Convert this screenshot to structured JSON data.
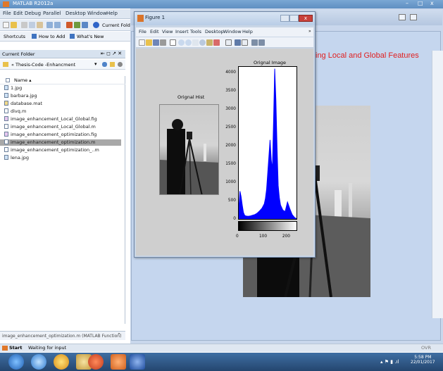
{
  "matlab": {
    "title": "MATLAB R2012a",
    "menu": [
      "File",
      "Edit",
      "Debug",
      "Parallel",
      "Desktop",
      "Window",
      "Help"
    ],
    "current_folder_label": "Current Folder:",
    "shortcuts": [
      "Shortcuts",
      "How to Add",
      "What's New"
    ],
    "window_controls": [
      "–",
      "□",
      "x"
    ]
  },
  "current_folder": {
    "panel_title": "Current Folder",
    "path": "« Thesis-Code -Enhancment",
    "column_header": "Name ▴",
    "files": [
      {
        "name": "1.jpg",
        "icon": "image-file-icon"
      },
      {
        "name": "barbara.jpg",
        "icon": "image-file-icon"
      },
      {
        "name": "database.mat",
        "icon": "mat-file-icon"
      },
      {
        "name": "divq.m",
        "icon": "m-file-icon"
      },
      {
        "name": "image_enhancement_Local_Global.fig",
        "icon": "fig-file-icon"
      },
      {
        "name": "image_enhancement_Local_Global.m",
        "icon": "m-file-icon"
      },
      {
        "name": "image_enhancement_optimization.fig",
        "icon": "fig-file-icon"
      },
      {
        "name": "image_enhancement_optimization.m",
        "icon": "m-file-icon",
        "selected": true
      },
      {
        "name": "image_enhancement_optimization_..m",
        "icon": "m-file-icon"
      },
      {
        "name": "lena.jpg",
        "icon": "image-file-icon"
      }
    ],
    "details": "image_enhancement_optimization.m (MATLAB Function)"
  },
  "status": {
    "start": "Start",
    "text": "Waiting for input",
    "ovr": "OVR"
  },
  "gui": {
    "heading_fragment": "ing Local and Global Features"
  },
  "figure": {
    "title": "Figure 1",
    "menu": [
      "File",
      "Edit",
      "View",
      "Insert",
      "Tools",
      "Desktop",
      "Window",
      "Help"
    ],
    "left_title": "Orignal Hist",
    "right_title": "Orignal Image"
  },
  "chart_data": {
    "type": "area",
    "title": "Orignal Image",
    "xlabel": "",
    "ylabel": "",
    "xlim": [
      0,
      255
    ],
    "ylim": [
      0,
      4200
    ],
    "y_ticks": [
      0,
      500,
      1000,
      1500,
      2000,
      2500,
      3000,
      3500,
      4000
    ],
    "x_ticks": [
      0,
      100,
      200
    ],
    "grid": false,
    "color": "#0000ff",
    "series": [
      {
        "x": [
          0,
          5,
          10,
          15,
          20,
          25,
          30,
          40,
          50,
          60,
          70,
          80,
          90,
          100,
          110,
          115,
          120,
          125,
          130,
          135,
          140,
          145,
          150,
          155,
          160,
          165,
          170,
          175,
          180,
          190,
          200,
          210,
          220,
          230,
          240,
          250,
          255
        ],
        "values": [
          300,
          800,
          650,
          420,
          220,
          140,
          120,
          110,
          120,
          140,
          160,
          200,
          260,
          330,
          450,
          600,
          850,
          1300,
          1750,
          2200,
          1650,
          1400,
          2700,
          4150,
          3300,
          2000,
          950,
          620,
          420,
          280,
          240,
          500,
          320,
          160,
          80,
          40,
          20
        ]
      }
    ]
  },
  "taskbar": {
    "time": "5:58 PM",
    "date": "22/01/2017"
  }
}
